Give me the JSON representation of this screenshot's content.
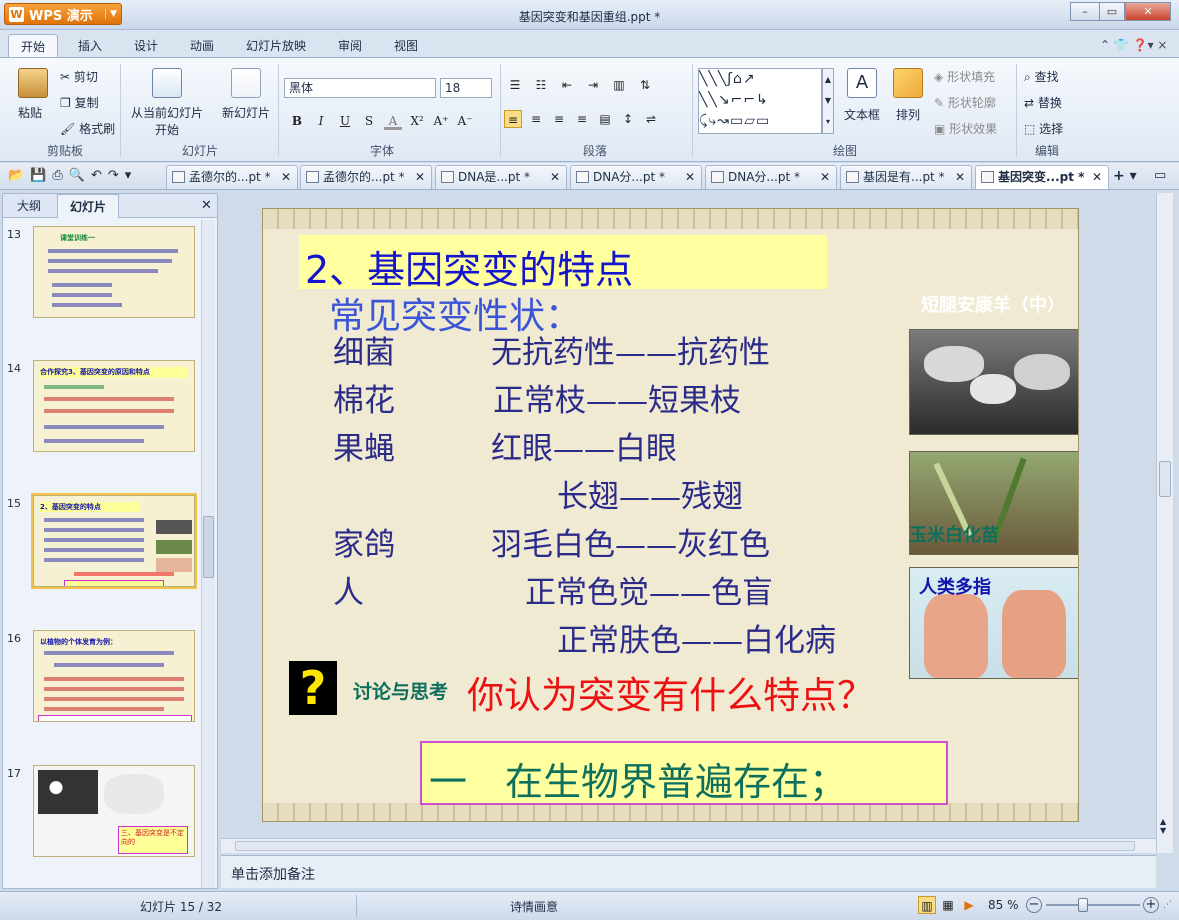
{
  "app": {
    "name": "WPS 演示",
    "title": "基因突变和基因重组.ppt *"
  },
  "ribbon_tabs": [
    "开始",
    "插入",
    "设计",
    "动画",
    "幻灯片放映",
    "审阅",
    "视图"
  ],
  "clipboard": {
    "paste": "粘贴",
    "cut": "剪切",
    "copy": "复制",
    "format_painter": "格式刷",
    "label": "剪贴板"
  },
  "slides_group": {
    "from_current": "从当前幻灯片",
    "start": "开始",
    "new_slide": "新幻灯片",
    "label": "幻灯片"
  },
  "font": {
    "name": "黑体",
    "size": "18",
    "label": "字体"
  },
  "paragraph": {
    "label": "段落"
  },
  "drawing": {
    "textbox": "文本框",
    "arrange": "排列",
    "shape_fill": "形状填充",
    "shape_outline": "形状轮廓",
    "shape_effect": "形状效果",
    "label": "绘图"
  },
  "editing": {
    "find": "查找",
    "replace": "替换",
    "select": "选择",
    "label": "编辑"
  },
  "doc_tabs": [
    "孟德尔的...pt *",
    "孟德尔的...pt *",
    "DNA是...pt *",
    "DNA分...pt *",
    "DNA分...pt *",
    "基因是有...pt *",
    "基因突变...pt *"
  ],
  "left_panel": {
    "tab_outline": "大纲",
    "tab_slides": "幻灯片"
  },
  "thumbnails": [
    {
      "num": "13",
      "title": "课堂训练一"
    },
    {
      "num": "14",
      "title": "合作探究3、基因突变的原因和特点"
    },
    {
      "num": "15",
      "title": "2、基因突变的特点"
    },
    {
      "num": "16",
      "title": "以植物的个体发育为例："
    },
    {
      "num": "17",
      "title": "三、基因突变是不定向的"
    }
  ],
  "slide": {
    "title": "2、基因突变的特点",
    "subtitle": "常见突变性状：",
    "rows": [
      {
        "org": "细菌",
        "trait": "无抗药性——抗药性"
      },
      {
        "org": "棉花",
        "trait": "正常枝——短果枝"
      },
      {
        "org": "果蝇",
        "trait": "红眼——白眼"
      },
      {
        "org": "",
        "trait": "长翅——残翅"
      },
      {
        "org": "家鸽",
        "trait": "羽毛白色——灰红色"
      },
      {
        "org": "人",
        "trait": "正常色觉——色盲"
      },
      {
        "org": "",
        "trait": "正常肤色——白化病"
      }
    ],
    "photo_labels": {
      "sheep": "短腿安康羊（中）",
      "corn": "玉米白化苗",
      "hands": "人类多指"
    },
    "discuss": "讨论与思考",
    "question": "你认为突变有什么特点？",
    "answer": "一　在生物界普遍存在；"
  },
  "notes": "单击添加备注",
  "status": {
    "slide": "幻灯片 15 / 32",
    "theme": "诗情画意",
    "zoom": "85 %"
  },
  "colors": {
    "title_blue": "#1414cc",
    "trait_navy": "#2b2b8a",
    "red": "#ee1111",
    "teal": "#0e6f5c"
  }
}
